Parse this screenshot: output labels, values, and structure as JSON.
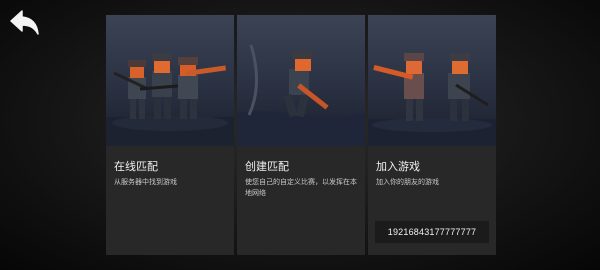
{
  "header": {
    "back_icon": "back-arrow-icon"
  },
  "cards": [
    {
      "title": "在线匹配",
      "description": "从服务器中找到游戏"
    },
    {
      "title": "创建匹配",
      "description": "使您自己的自定义比赛，以发挥在本地网络"
    },
    {
      "title": "加入游戏",
      "description": "加入你的朋友的游戏",
      "join_code": "19216843177777777"
    }
  ],
  "colors": {
    "background": "#161616",
    "card": "#282828",
    "code_box": "#1b1b1b",
    "accent_orange": "#d9622b"
  }
}
